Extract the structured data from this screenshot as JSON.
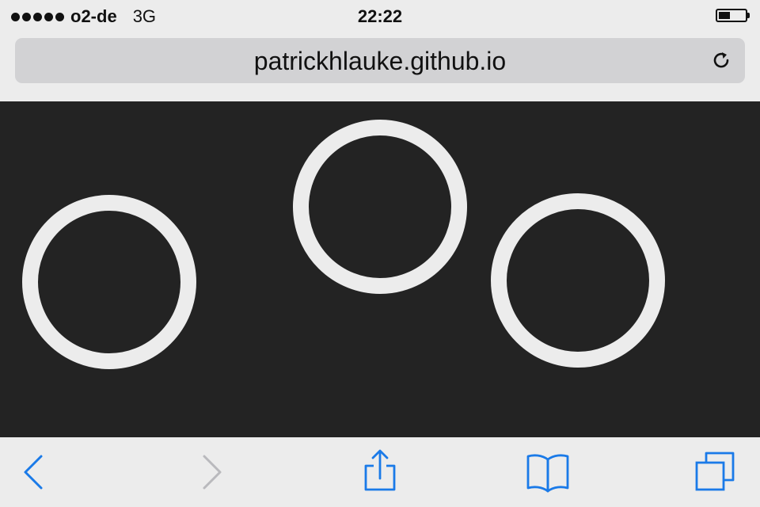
{
  "status_bar": {
    "carrier": "o2-de",
    "network": "3G",
    "time": "22:22",
    "signal_strength": 5,
    "battery_level": 0.45
  },
  "browser": {
    "url": "patrickhlauke.github.io",
    "accent_color": "#1a7ae8"
  },
  "page": {
    "background_color": "#232323",
    "touch_points": [
      {
        "id": "touch-1"
      },
      {
        "id": "touch-2"
      },
      {
        "id": "touch-3"
      }
    ],
    "ring_color": "#ececec"
  },
  "toolbar": {
    "icons": [
      "back-icon",
      "forward-icon",
      "share-icon",
      "bookmarks-icon",
      "tabs-icon"
    ]
  }
}
